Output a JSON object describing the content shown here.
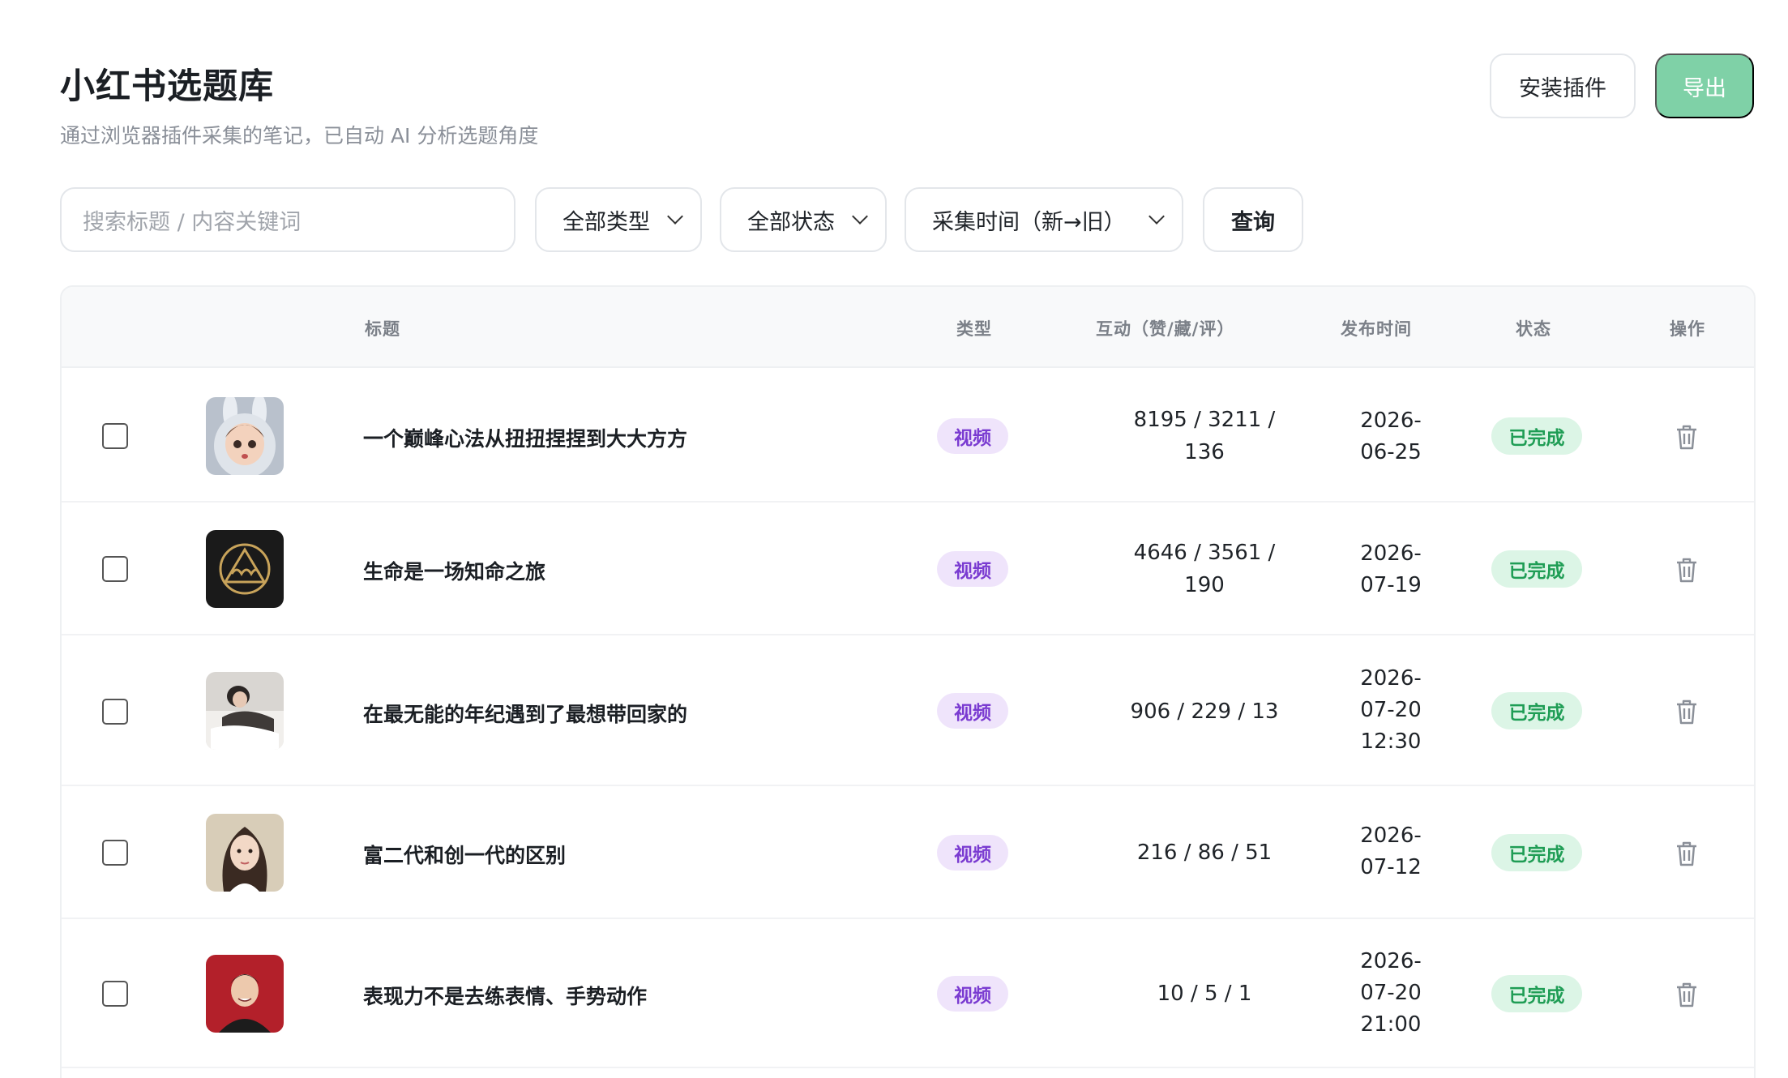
{
  "header": {
    "title": "小红书选题库",
    "subtitle": "通过浏览器插件采集的笔记，已自动 AI 分析选题角度",
    "install_label": "安装插件",
    "export_label": "导出"
  },
  "filters": {
    "search_placeholder": "搜索标题 / 内容关键词",
    "type_value": "全部类型",
    "status_value": "全部状态",
    "sort_value": "采集时间（新→旧）",
    "query_label": "查询"
  },
  "table": {
    "columns": {
      "title": "标题",
      "type": "类型",
      "interaction": "互动（赞/藏/评）",
      "published": "发布时间",
      "status": "状态",
      "actions": "操作"
    },
    "rows": [
      {
        "title": "一个巅峰心法从扭扭捏捏到大大方方",
        "type": "视频",
        "interaction_line1": "8195 / 3211 /",
        "interaction_line2": "136",
        "date_line1": "2026-",
        "date_line2": "06-25",
        "date_line3": "",
        "status": "已完成",
        "thumb": "bunny-girl"
      },
      {
        "title": "生命是一场知命之旅",
        "type": "视频",
        "interaction_line1": "4646 / 3561 /",
        "interaction_line2": "190",
        "date_line1": "2026-",
        "date_line2": "07-19",
        "date_line3": "",
        "status": "已完成",
        "thumb": "mountain-logo"
      },
      {
        "title": "在最无能的年纪遇到了最想带回家的",
        "type": "视频",
        "interaction_line1": "906 / 229 / 13",
        "interaction_line2": "",
        "date_line1": "2026-",
        "date_line2": "07-20",
        "date_line3": "12:30",
        "status": "已完成",
        "thumb": "bed-person"
      },
      {
        "title": "富二代和创一代的区别",
        "type": "视频",
        "interaction_line1": "216 / 86 / 51",
        "interaction_line2": "",
        "date_line1": "2026-",
        "date_line2": "07-12",
        "date_line3": "",
        "status": "已完成",
        "thumb": "woman-portrait"
      },
      {
        "title": "表现力不是去练表情、手势动作",
        "type": "视频",
        "interaction_line1": "10 / 5 / 1",
        "interaction_line2": "",
        "date_line1": "2026-",
        "date_line2": "07-20",
        "date_line3": "21:00",
        "status": "已完成",
        "thumb": "man-red-background"
      }
    ]
  },
  "colors": {
    "accent_green": "#7fd1a7",
    "type_tag_bg": "#efe4fb",
    "type_tag_text": "#7a3bd1",
    "status_bg": "#dcf5e6",
    "status_text": "#1f9d55"
  }
}
